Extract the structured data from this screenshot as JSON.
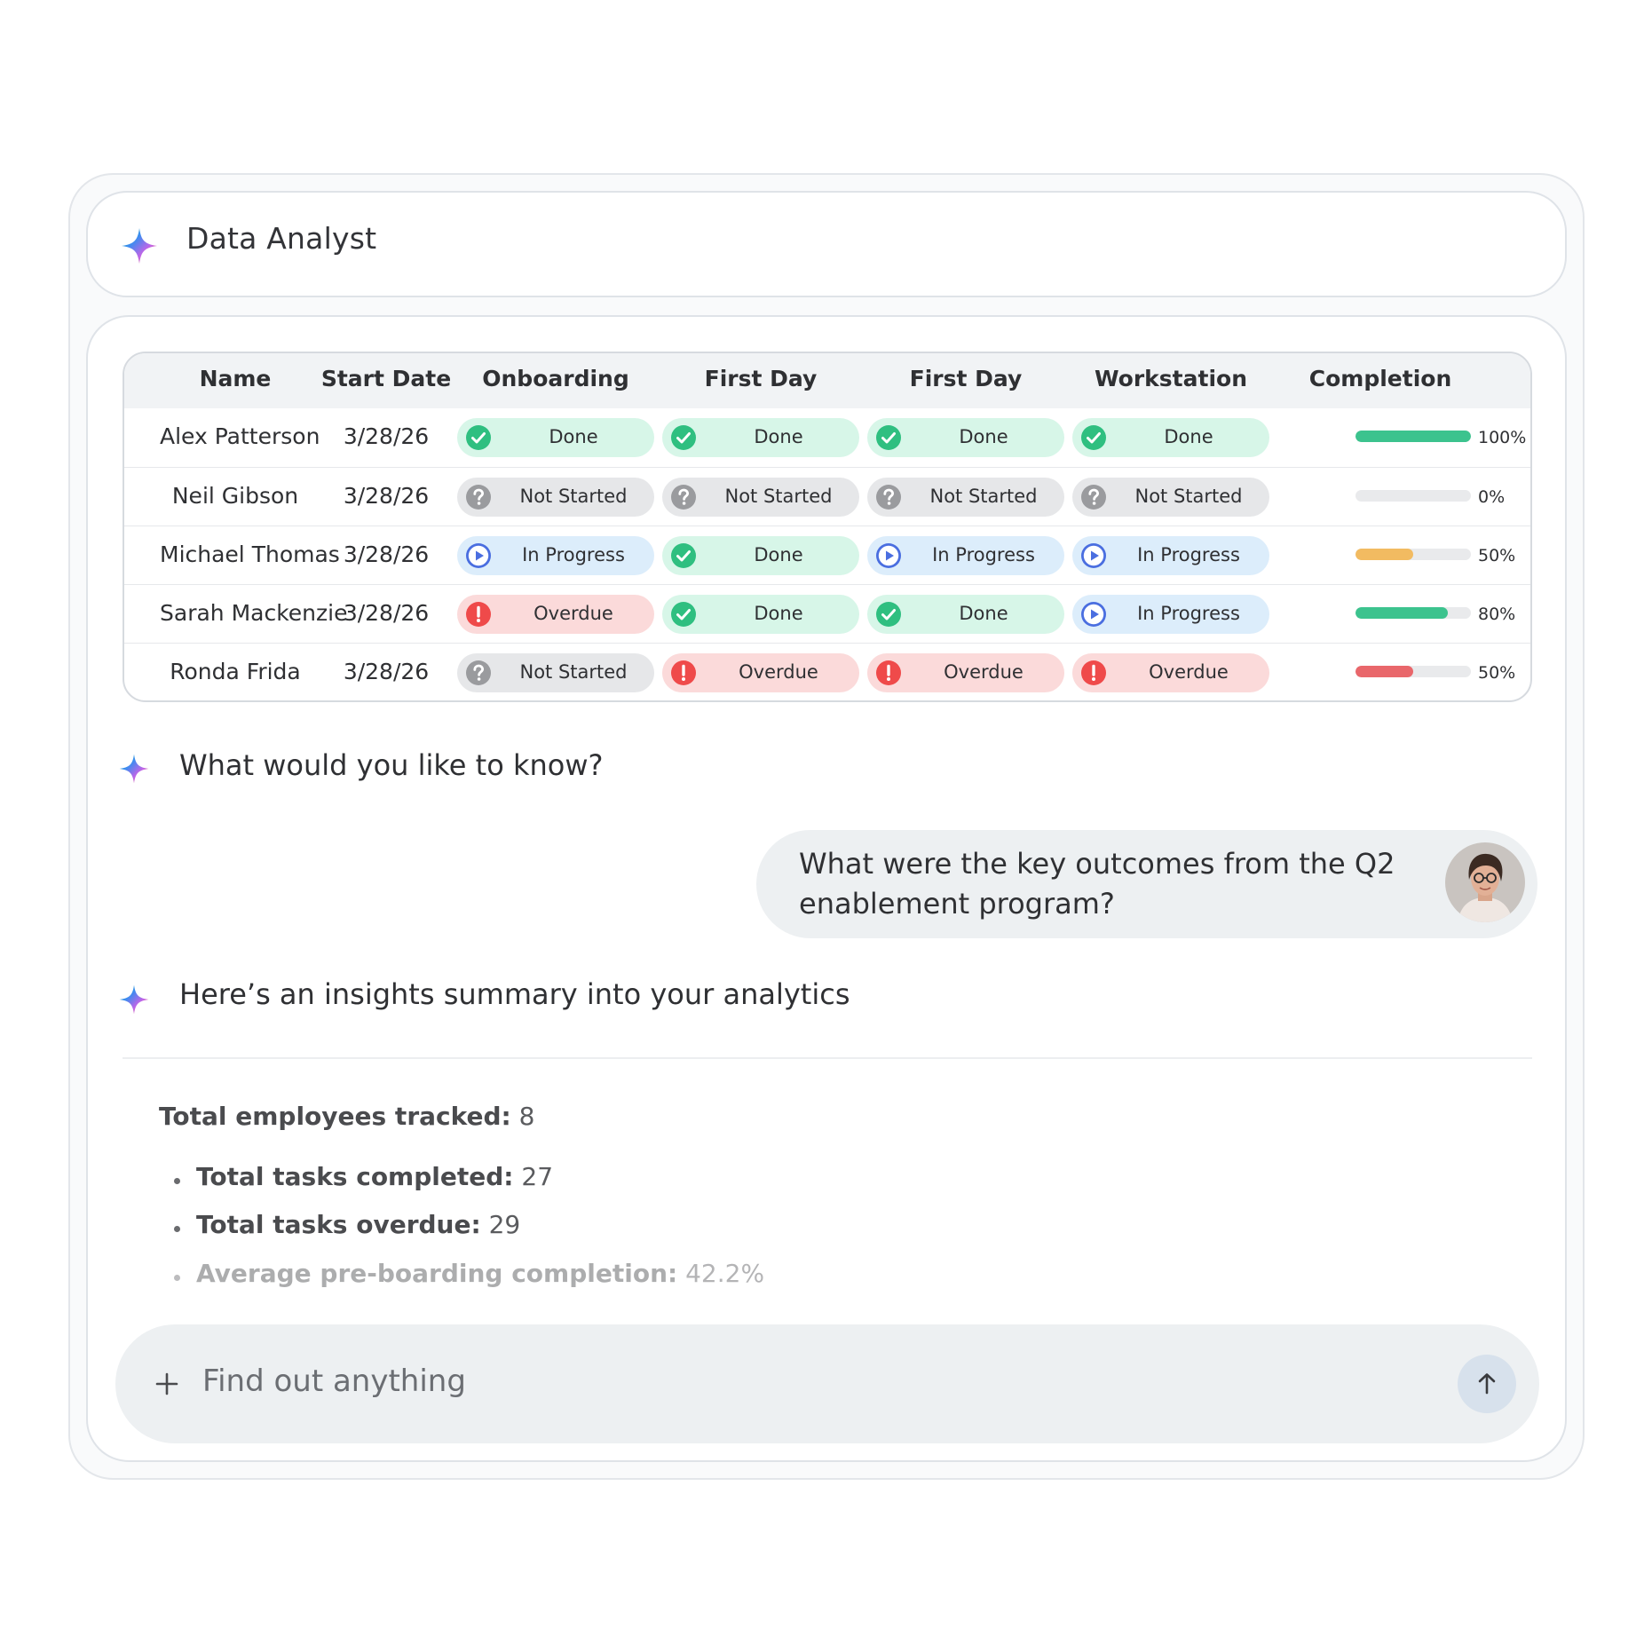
{
  "header": {
    "title": "Data Analyst",
    "icon": "sparkle-icon"
  },
  "table": {
    "columns": [
      "Name",
      "Start Date",
      "Onboarding",
      "First Day",
      "First Day",
      "Workstation",
      "Completion"
    ],
    "rows": [
      {
        "name": "Alex Patterson",
        "start_date": "3/28/26",
        "statuses": [
          "Done",
          "Done",
          "Done",
          "Done"
        ],
        "kinds": [
          "done",
          "done",
          "done",
          "done"
        ],
        "completion": 1.0,
        "completion_label": "100%",
        "bar_color": "#3cc38e"
      },
      {
        "name": "Neil Gibson",
        "start_date": "3/28/26",
        "statuses": [
          "Not Started",
          "Not Started",
          "Not Started",
          "Not Started"
        ],
        "kinds": [
          "not-started",
          "not-started",
          "not-started",
          "not-started"
        ],
        "completion": 0.0,
        "completion_label": "0%",
        "bar_color": "#3cc38e"
      },
      {
        "name": "Michael Thomas",
        "start_date": "3/28/26",
        "statuses": [
          "In Progress",
          "Done",
          "In Progress",
          "In Progress"
        ],
        "kinds": [
          "in-progress",
          "done",
          "in-progress",
          "in-progress"
        ],
        "completion": 0.5,
        "completion_label": "50%",
        "bar_color": "#f2bb61"
      },
      {
        "name": "Sarah Mackenzie",
        "start_date": "3/28/26",
        "statuses": [
          "Overdue",
          "Done",
          "Done",
          "In Progress"
        ],
        "kinds": [
          "overdue",
          "done",
          "done",
          "in-progress"
        ],
        "completion": 0.8,
        "completion_label": "80%",
        "bar_color": "#3cc38e"
      },
      {
        "name": "Ronda Frida",
        "start_date": "3/28/26",
        "statuses": [
          "Not Started",
          "Overdue",
          "Overdue",
          "Overdue"
        ],
        "kinds": [
          "not-started",
          "overdue",
          "overdue",
          "overdue"
        ],
        "completion": 0.5,
        "completion_label": "50%",
        "bar_color": "#e9676b"
      }
    ]
  },
  "chat": {
    "assistant_prompt": "What would you like to know?",
    "user_message": "What were the key outcomes from the Q2 enablement program?",
    "assistant_reply": "Here’s an insights summary into your analytics"
  },
  "summary": {
    "total_label": "Total employees tracked:",
    "total_value": "8",
    "items": [
      {
        "label": "Total tasks completed:",
        "value": "27"
      },
      {
        "label": "Total tasks overdue:",
        "value": "29"
      },
      {
        "label": "Average pre-boarding completion:",
        "value": "42.2%"
      }
    ]
  },
  "input": {
    "placeholder": "Find out anything",
    "add_icon": "plus-icon",
    "send_icon": "arrow-up-icon"
  },
  "status_colors": {
    "done": "#2fbf80",
    "not-started": "#9a9b9e",
    "in-progress": "#4a6ee0",
    "overdue": "#ef4a4a"
  }
}
